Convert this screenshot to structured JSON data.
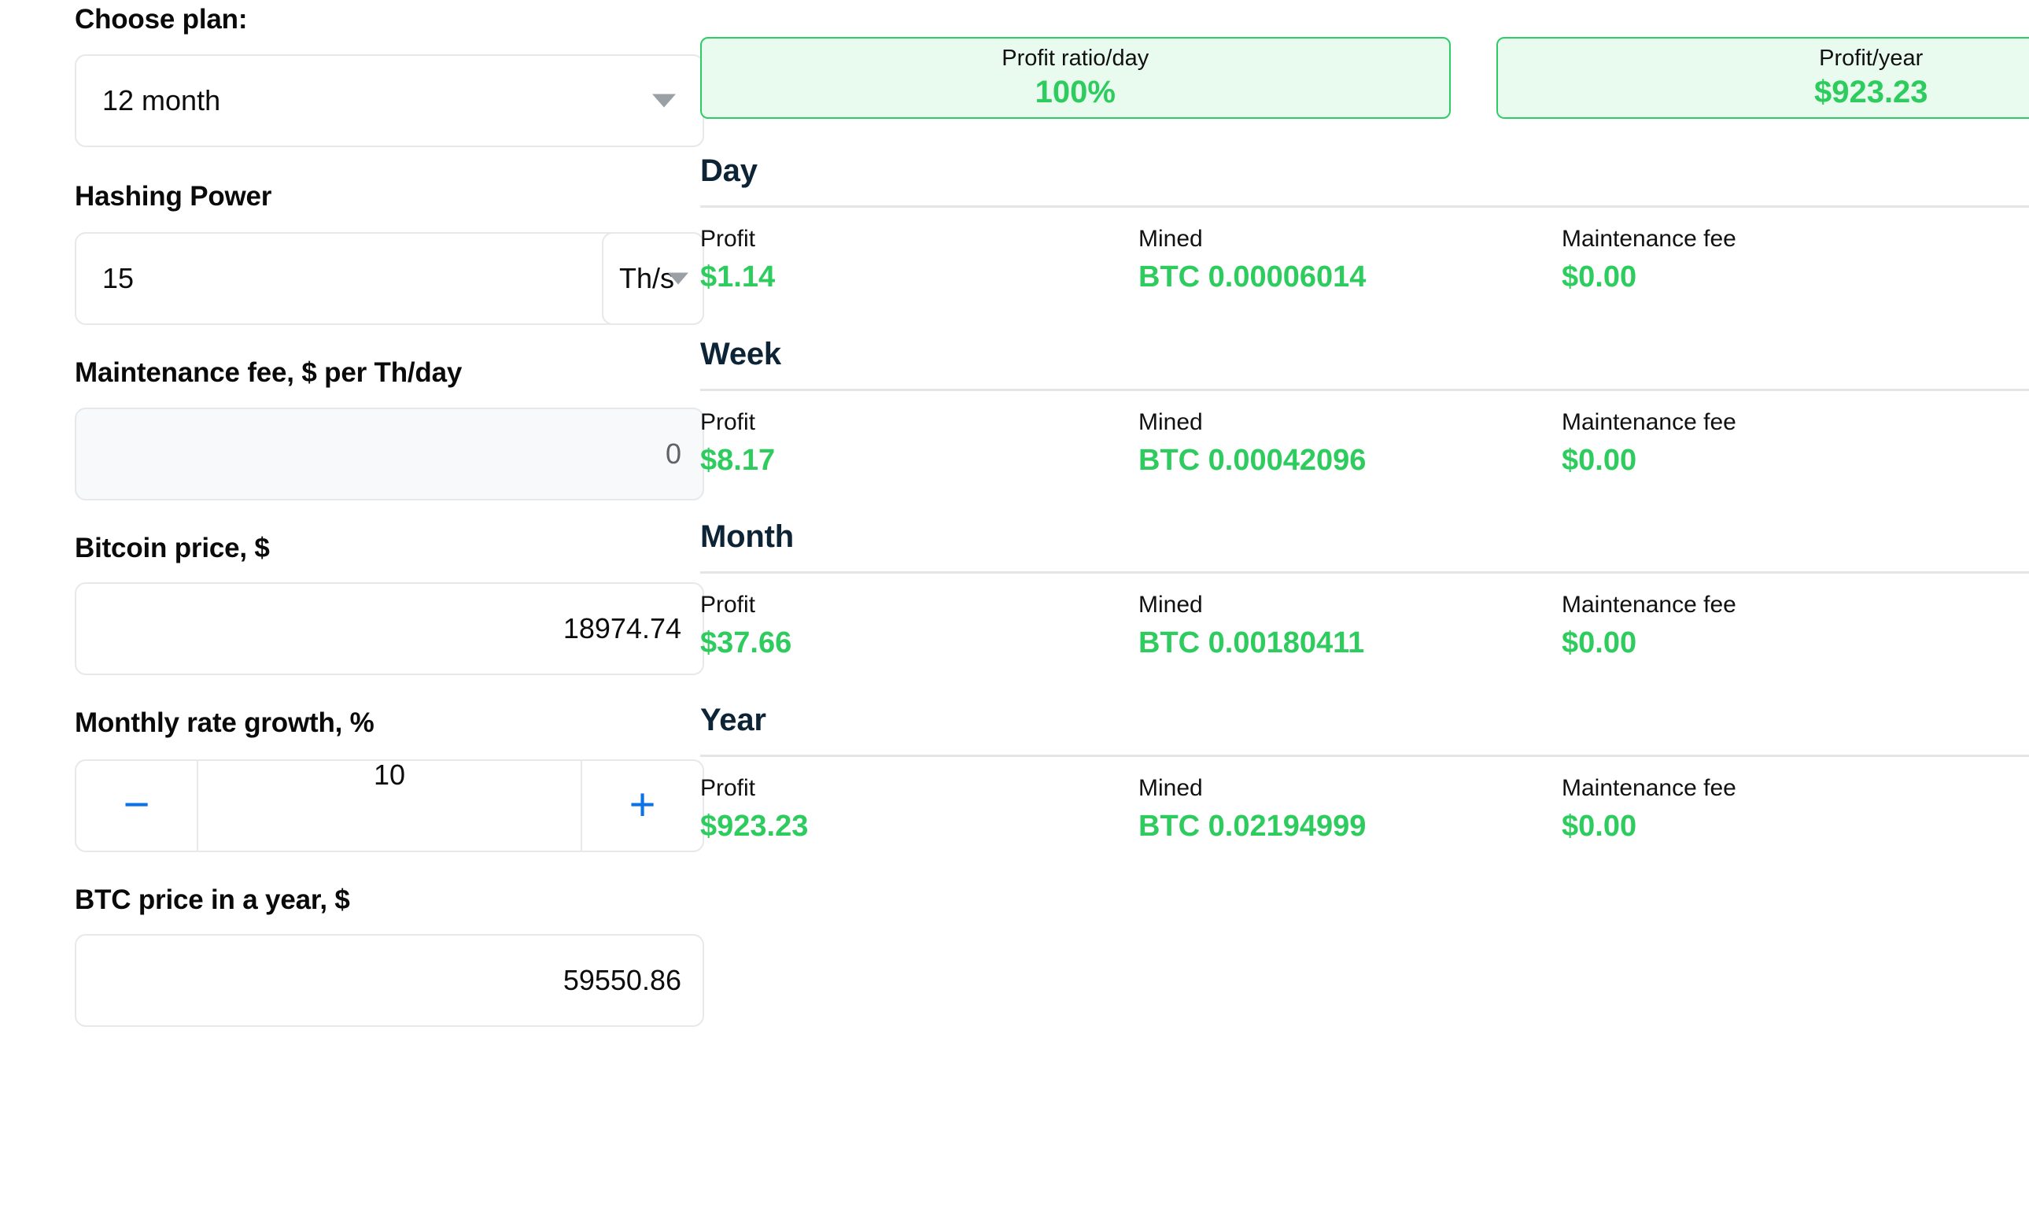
{
  "form": {
    "plan": {
      "label": "Choose plan:",
      "value": "12 month",
      "caret_icon": "chevron-down-icon"
    },
    "hashing_power": {
      "label": "Hashing Power",
      "value": "15",
      "unit": "Th/s",
      "caret_icon": "chevron-down-icon"
    },
    "maintenance_fee": {
      "label": "Maintenance fee, $ per Th/day",
      "value": "0"
    },
    "bitcoin_price": {
      "label": "Bitcoin price, $",
      "value": "18974.74"
    },
    "monthly_rate_growth": {
      "label": "Monthly rate growth, %",
      "value": "10",
      "decrement_label": "−",
      "increment_label": "+",
      "decrement_icon": "minus-icon",
      "increment_icon": "plus-icon"
    },
    "btc_price_in_year": {
      "label": "BTC price in a year, $",
      "value": "59550.86"
    }
  },
  "results": {
    "summary": [
      {
        "title": "Profit ratio/day",
        "value": "100%"
      },
      {
        "title": "Profit/year",
        "value": "$923.23"
      }
    ],
    "column_headers": [
      "Profit",
      "Mined",
      "Maintenance fee"
    ],
    "periods": [
      {
        "title": "Day",
        "profit": "$1.14",
        "mined": "BTC 0.00006014",
        "maintenance_fee": "$0.00"
      },
      {
        "title": "Week",
        "profit": "$8.17",
        "mined": "BTC 0.00042096",
        "maintenance_fee": "$0.00"
      },
      {
        "title": "Month",
        "profit": "$37.66",
        "mined": "BTC 0.00180411",
        "maintenance_fee": "$0.00"
      },
      {
        "title": "Year",
        "profit": "$923.23",
        "mined": "BTC 0.02194999",
        "maintenance_fee": "$0.00"
      }
    ]
  },
  "colors": {
    "accent_green": "#2ecc5e",
    "card_border_green": "#2ecc66",
    "card_fill_green": "#e9fbef",
    "accent_blue": "#0b72e7",
    "heading_navy": "#0d2436",
    "border_gray": "#e6e8ea"
  }
}
